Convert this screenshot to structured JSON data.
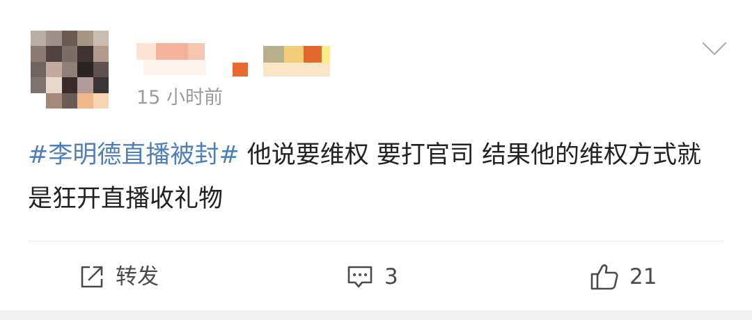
{
  "post": {
    "avatar_icon": "blurred-avatar",
    "username_icon": "blurred-username",
    "time": "15 小时前",
    "content": {
      "hashtag": "#李明德直播被封#",
      "text": " 他说要维权 要打官司 结果他的维权方式就是狂开直播收礼物"
    },
    "menu_icon": "chevron-down-icon"
  },
  "actions": {
    "repost": {
      "icon": "share-icon",
      "label": "转发"
    },
    "comment": {
      "icon": "comment-icon",
      "label": "3"
    },
    "like": {
      "icon": "thumbs-up-icon",
      "label": "21"
    }
  },
  "colors": {
    "hashtag": "#4f7fb8",
    "text": "#222222",
    "secondary": "#9a9a9a",
    "background": "#f2f2f2"
  }
}
